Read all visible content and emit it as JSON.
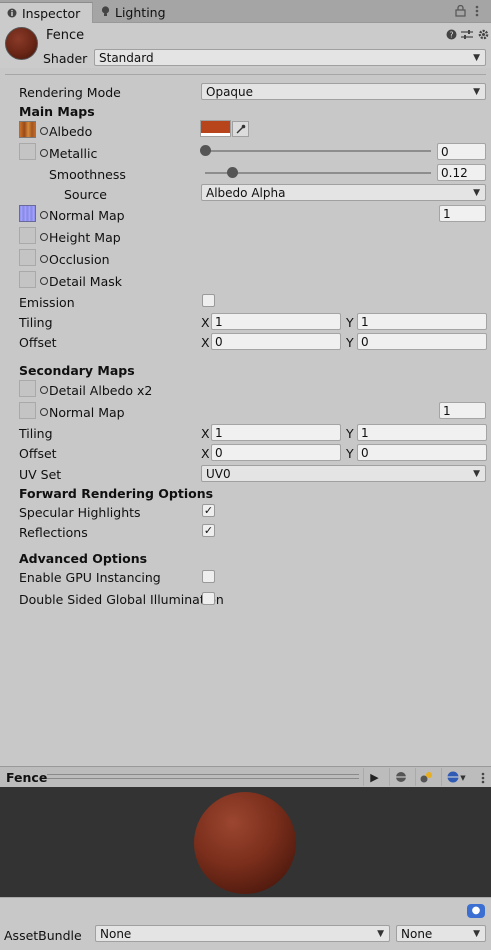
{
  "tabs": {
    "inspector": "Inspector",
    "lighting": "Lighting"
  },
  "material": {
    "name": "Fence",
    "shader_label": "Shader",
    "shader_value": "Standard"
  },
  "rendering_mode": {
    "label": "Rendering Mode",
    "value": "Opaque"
  },
  "main_maps": {
    "title": "Main Maps",
    "albedo": "Albedo",
    "albedo_color": "#b8441c",
    "metallic": "Metallic",
    "metallic_value": "0",
    "metallic_level": 0,
    "smoothness": "Smoothness",
    "smoothness_value": "0.12",
    "smoothness_level": 0.12,
    "source": "Source",
    "source_value": "Albedo Alpha",
    "normal_map": "Normal Map",
    "normal_value": "1",
    "height_map": "Height Map",
    "occlusion": "Occlusion",
    "detail_mask": "Detail Mask",
    "emission": "Emission",
    "tiling": "Tiling",
    "offset": "Offset",
    "tiling_x": "1",
    "tiling_y": "1",
    "offset_x": "0",
    "offset_y": "0"
  },
  "secondary_maps": {
    "title": "Secondary Maps",
    "detail_albedo": "Detail Albedo x2",
    "normal_map": "Normal Map",
    "normal_value": "1",
    "tiling": "Tiling",
    "offset": "Offset",
    "tiling_x": "1",
    "tiling_y": "1",
    "offset_x": "0",
    "offset_y": "0",
    "uv_set": "UV Set",
    "uv_set_value": "UV0"
  },
  "axis": {
    "x": "X",
    "y": "Y"
  },
  "forward": {
    "title": "Forward Rendering Options",
    "specular": "Specular Highlights",
    "specular_checked": "✓",
    "reflections": "Reflections",
    "reflections_checked": "✓"
  },
  "advanced": {
    "title": "Advanced Options",
    "gpu_instancing": "Enable GPU Instancing",
    "double_sided": "Double Sided Global Illumination"
  },
  "preview": {
    "title": "Fence"
  },
  "asset_bundle": {
    "label": "AssetBundle",
    "name": "None",
    "variant": "None"
  },
  "icons": {
    "info": "info-icon",
    "lighting": "bulb-icon",
    "lock": "lock-icon",
    "menu": "kebab-icon",
    "help": "help-icon",
    "preset": "sliders-icon",
    "gear": "gear-icon",
    "eyedropper": "eyedropper-icon",
    "play": "play-icon",
    "tag": "tag-icon"
  }
}
